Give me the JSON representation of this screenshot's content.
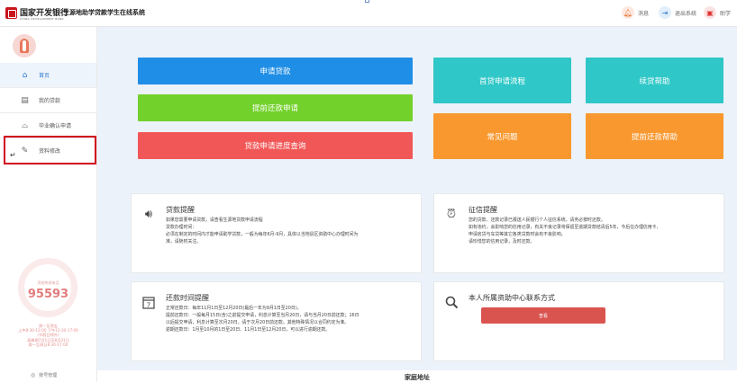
{
  "header": {
    "bank_name": "国家开发银行",
    "bank_english": "CHINA DEVELOPMENT BANK",
    "system_name": "生源地助学贷款学生在线系统",
    "message_label": "消息",
    "logout_label": "退出系统",
    "help_label": "助学"
  },
  "sidebar": {
    "items": [
      {
        "label": "首页",
        "icon": "home-icon",
        "glyph": "⌂"
      },
      {
        "label": "我的贷款",
        "icon": "document-icon",
        "glyph": "▤"
      },
      {
        "label": "毕业确认申请",
        "icon": "graduation-cap-icon",
        "glyph": "⌓"
      },
      {
        "label": "资料修改",
        "icon": "edit-icon",
        "glyph": "✎"
      }
    ],
    "hotline_label": "资助热线电话",
    "hotline_number": "95593",
    "hotline_hours": [
      "周一至周五",
      "上午8:30-12:00 下午13:30-17:00",
      "（节假日除外）",
      "高峰期7月1日至8月31日",
      "周一至周日8:30-17:00"
    ],
    "account_label": "账号管理"
  },
  "main": {
    "actions_left": [
      "申请贷款",
      "提前还款申请",
      "贷款申请进度查询"
    ],
    "actions_right": [
      "首贷申请流程",
      "续贷帮助",
      "常见问题",
      "提前还款帮助"
    ],
    "cards": {
      "loan_reminder": {
        "title": "贷款提醒",
        "lines": [
          "如果您需要申请贷款，请查看生源地贷款申请流程",
          "贷款办理时间：",
          "必须在制定的时间内才能申请助学贷款，一般为每年6月-9月，具体以当地县区资助中心办理时间为",
          "准，请随时关注。"
        ]
      },
      "credit_reminder": {
        "title": "征信提醒",
        "lines": [
          "您的贷款、还款记录已报送人民银行个人征信系统，请务必按时还款。",
          "如有违约，会影响您的信用记录，有关不良记录将保留至逾期贷款结清后5年，今后在办理信用卡、",
          "申请房贷与车贷等其它各类贷款时会有不良影响。",
          "请珍惜您的信用记录，及时还款。"
        ]
      },
      "repay_reminder": {
        "title": "还款时间提醒",
        "lines": [
          "正常还款日：每年11月1日至12月20日(最后一年为9月1日至20日)。",
          "提前还款日：一般每月15日(含)之前提交申请，利息计算至当月20日，请与当月20日前还款；16日",
          "以后提交申请，利息计算至次月20日，请于次月20日前还款。其他特殊情况以合同约定为准。",
          "逾期还款日：1月至10月的1日至20日、11月1日至12月20日，可以进行逾期还款。"
        ]
      },
      "contact_info": {
        "title": "本人所属资助中心联系方式",
        "button_label": "查看"
      }
    },
    "bottom_title": "家庭地址"
  }
}
